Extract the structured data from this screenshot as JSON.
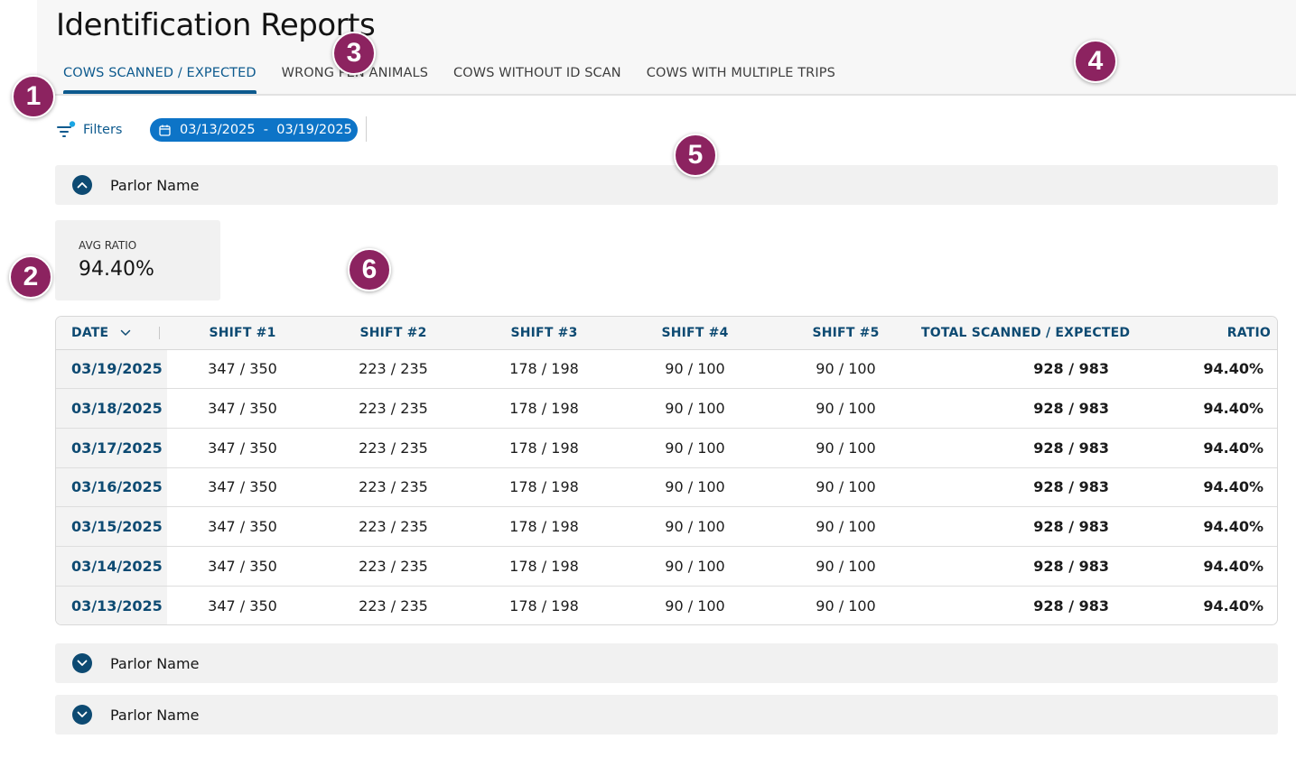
{
  "page_title": "Identification Reports",
  "tabs": [
    {
      "label": "COWS SCANNED / EXPECTED",
      "active": true
    },
    {
      "label": "WRONG PEN ANIMALS",
      "active": false
    },
    {
      "label": "COWS WITHOUT ID SCAN",
      "active": false
    },
    {
      "label": "COWS WITH MULTIPLE TRIPS",
      "active": false
    }
  ],
  "filters": {
    "label": "Filters",
    "icon": "filter-icon",
    "date_range": "03/13/2025  -  03/19/2025",
    "date_icon": "calendar-icon"
  },
  "parlors": [
    {
      "label": "Parlor Name",
      "expanded": true
    },
    {
      "label": "Parlor Name",
      "expanded": false
    },
    {
      "label": "Parlor Name",
      "expanded": false
    }
  ],
  "avg_ratio": {
    "label": "AVG RATIO",
    "value": "94.40%"
  },
  "table": {
    "headers": {
      "date": "DATE",
      "shift1": "SHIFT #1",
      "shift2": "SHIFT #2",
      "shift3": "SHIFT #3",
      "shift4": "SHIFT #4",
      "shift5": "SHIFT #5",
      "total": "TOTAL SCANNED / EXPECTED",
      "ratio": "RATIO"
    },
    "rows": [
      {
        "date": "03/19/2025",
        "s1": "347 / 350",
        "s2": "223 / 235",
        "s3": "178 / 198",
        "s4": "90 / 100",
        "s5": "90 / 100",
        "total": "928 / 983",
        "ratio": "94.40%"
      },
      {
        "date": "03/18/2025",
        "s1": "347 / 350",
        "s2": "223 / 235",
        "s3": "178 / 198",
        "s4": "90 / 100",
        "s5": "90 / 100",
        "total": "928 / 983",
        "ratio": "94.40%"
      },
      {
        "date": "03/17/2025",
        "s1": "347 / 350",
        "s2": "223 / 235",
        "s3": "178 / 198",
        "s4": "90 / 100",
        "s5": "90 / 100",
        "total": "928 / 983",
        "ratio": "94.40%"
      },
      {
        "date": "03/16/2025",
        "s1": "347 / 350",
        "s2": "223 / 235",
        "s3": "178 / 198",
        "s4": "90 / 100",
        "s5": "90 / 100",
        "total": "928 / 983",
        "ratio": "94.40%"
      },
      {
        "date": "03/15/2025",
        "s1": "347 / 350",
        "s2": "223 / 235",
        "s3": "178 / 198",
        "s4": "90 / 100",
        "s5": "90 / 100",
        "total": "928 / 983",
        "ratio": "94.40%"
      },
      {
        "date": "03/14/2025",
        "s1": "347 / 350",
        "s2": "223 / 235",
        "s3": "178 / 198",
        "s4": "90 / 100",
        "s5": "90 / 100",
        "total": "928 / 983",
        "ratio": "94.40%"
      },
      {
        "date": "03/13/2025",
        "s1": "347 / 350",
        "s2": "223 / 235",
        "s3": "178 / 198",
        "s4": "90 / 100",
        "s5": "90 / 100",
        "total": "928 / 983",
        "ratio": "94.40%"
      }
    ]
  },
  "annotation_markers": [
    "1",
    "2",
    "3",
    "4",
    "5",
    "6"
  ],
  "colors": {
    "accent": "#0d5a8e",
    "chip": "#0d74c7",
    "marker": "#8c2360",
    "toggle": "#0d4a72",
    "filter_dot": "#1aa6e4"
  }
}
